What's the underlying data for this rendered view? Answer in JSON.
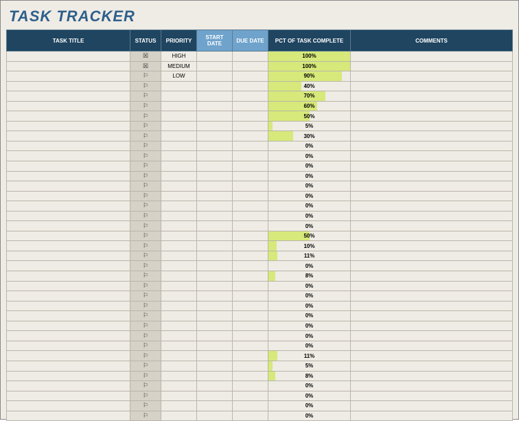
{
  "page_title": "TASK TRACKER",
  "columns": {
    "task_title": "TASK TITLE",
    "status": "STATUS",
    "priority": "PRIORITY",
    "start_date": "START DATE",
    "due_date": "DUE DATE",
    "pct_complete": "PCT OF TASK COMPLETE",
    "comments": "COMMENTS"
  },
  "status_icons": {
    "done": "☒",
    "flag": "⚐"
  },
  "rows": [
    {
      "task_title": "",
      "status": "done",
      "priority": "HIGH",
      "start_date": "",
      "due_date": "",
      "pct": 100,
      "comments": ""
    },
    {
      "task_title": "",
      "status": "done",
      "priority": "MEDIUM",
      "start_date": "",
      "due_date": "",
      "pct": 100,
      "comments": ""
    },
    {
      "task_title": "",
      "status": "flag",
      "priority": "LOW",
      "start_date": "",
      "due_date": "",
      "pct": 90,
      "comments": ""
    },
    {
      "task_title": "",
      "status": "flag",
      "priority": "",
      "start_date": "",
      "due_date": "",
      "pct": 40,
      "comments": ""
    },
    {
      "task_title": "",
      "status": "flag",
      "priority": "",
      "start_date": "",
      "due_date": "",
      "pct": 70,
      "comments": ""
    },
    {
      "task_title": "",
      "status": "flag",
      "priority": "",
      "start_date": "",
      "due_date": "",
      "pct": 60,
      "comments": ""
    },
    {
      "task_title": "",
      "status": "flag",
      "priority": "",
      "start_date": "",
      "due_date": "",
      "pct": 50,
      "comments": ""
    },
    {
      "task_title": "",
      "status": "flag",
      "priority": "",
      "start_date": "",
      "due_date": "",
      "pct": 5,
      "comments": ""
    },
    {
      "task_title": "",
      "status": "flag",
      "priority": "",
      "start_date": "",
      "due_date": "",
      "pct": 30,
      "comments": ""
    },
    {
      "task_title": "",
      "status": "flag",
      "priority": "",
      "start_date": "",
      "due_date": "",
      "pct": 0,
      "comments": ""
    },
    {
      "task_title": "",
      "status": "flag",
      "priority": "",
      "start_date": "",
      "due_date": "",
      "pct": 0,
      "comments": ""
    },
    {
      "task_title": "",
      "status": "flag",
      "priority": "",
      "start_date": "",
      "due_date": "",
      "pct": 0,
      "comments": ""
    },
    {
      "task_title": "",
      "status": "flag",
      "priority": "",
      "start_date": "",
      "due_date": "",
      "pct": 0,
      "comments": ""
    },
    {
      "task_title": "",
      "status": "flag",
      "priority": "",
      "start_date": "",
      "due_date": "",
      "pct": 0,
      "comments": ""
    },
    {
      "task_title": "",
      "status": "flag",
      "priority": "",
      "start_date": "",
      "due_date": "",
      "pct": 0,
      "comments": ""
    },
    {
      "task_title": "",
      "status": "flag",
      "priority": "",
      "start_date": "",
      "due_date": "",
      "pct": 0,
      "comments": ""
    },
    {
      "task_title": "",
      "status": "flag",
      "priority": "",
      "start_date": "",
      "due_date": "",
      "pct": 0,
      "comments": ""
    },
    {
      "task_title": "",
      "status": "flag",
      "priority": "",
      "start_date": "",
      "due_date": "",
      "pct": 0,
      "comments": ""
    },
    {
      "task_title": "",
      "status": "flag",
      "priority": "",
      "start_date": "",
      "due_date": "",
      "pct": 50,
      "comments": ""
    },
    {
      "task_title": "",
      "status": "flag",
      "priority": "",
      "start_date": "",
      "due_date": "",
      "pct": 10,
      "comments": ""
    },
    {
      "task_title": "",
      "status": "flag",
      "priority": "",
      "start_date": "",
      "due_date": "",
      "pct": 11,
      "comments": ""
    },
    {
      "task_title": "",
      "status": "flag",
      "priority": "",
      "start_date": "",
      "due_date": "",
      "pct": 0,
      "comments": ""
    },
    {
      "task_title": "",
      "status": "flag",
      "priority": "",
      "start_date": "",
      "due_date": "",
      "pct": 8,
      "comments": ""
    },
    {
      "task_title": "",
      "status": "flag",
      "priority": "",
      "start_date": "",
      "due_date": "",
      "pct": 0,
      "comments": ""
    },
    {
      "task_title": "",
      "status": "flag",
      "priority": "",
      "start_date": "",
      "due_date": "",
      "pct": 0,
      "comments": ""
    },
    {
      "task_title": "",
      "status": "flag",
      "priority": "",
      "start_date": "",
      "due_date": "",
      "pct": 0,
      "comments": ""
    },
    {
      "task_title": "",
      "status": "flag",
      "priority": "",
      "start_date": "",
      "due_date": "",
      "pct": 0,
      "comments": ""
    },
    {
      "task_title": "",
      "status": "flag",
      "priority": "",
      "start_date": "",
      "due_date": "",
      "pct": 0,
      "comments": ""
    },
    {
      "task_title": "",
      "status": "flag",
      "priority": "",
      "start_date": "",
      "due_date": "",
      "pct": 0,
      "comments": ""
    },
    {
      "task_title": "",
      "status": "flag",
      "priority": "",
      "start_date": "",
      "due_date": "",
      "pct": 0,
      "comments": ""
    },
    {
      "task_title": "",
      "status": "flag",
      "priority": "",
      "start_date": "",
      "due_date": "",
      "pct": 11,
      "comments": ""
    },
    {
      "task_title": "",
      "status": "flag",
      "priority": "",
      "start_date": "",
      "due_date": "",
      "pct": 5,
      "comments": ""
    },
    {
      "task_title": "",
      "status": "flag",
      "priority": "",
      "start_date": "",
      "due_date": "",
      "pct": 8,
      "comments": ""
    },
    {
      "task_title": "",
      "status": "flag",
      "priority": "",
      "start_date": "",
      "due_date": "",
      "pct": 0,
      "comments": ""
    },
    {
      "task_title": "",
      "status": "flag",
      "priority": "",
      "start_date": "",
      "due_date": "",
      "pct": 0,
      "comments": ""
    },
    {
      "task_title": "",
      "status": "flag",
      "priority": "",
      "start_date": "",
      "due_date": "",
      "pct": 0,
      "comments": ""
    },
    {
      "task_title": "",
      "status": "flag",
      "priority": "",
      "start_date": "",
      "due_date": "",
      "pct": 0,
      "comments": ""
    }
  ]
}
